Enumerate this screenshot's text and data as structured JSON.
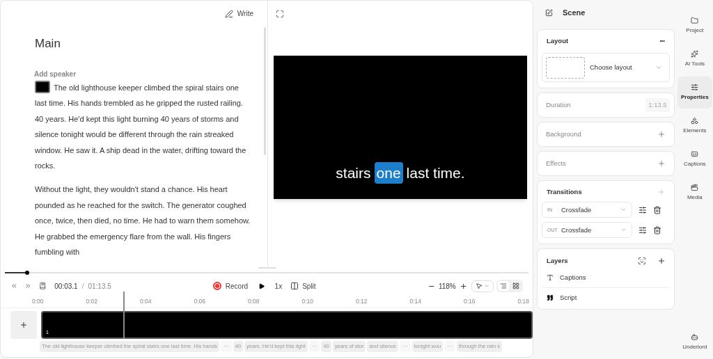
{
  "editor": {
    "write_label": "Write",
    "title": "Main",
    "speaker_label": "Add speaker",
    "paragraphs": [
      "The old lighthouse keeper climbed the spiral stairs one last time. His hands trembled as he gripped the rusted railing. 40 years. He'd kept this light burning 40 years of storms and silence tonight would be different through the rain streaked window. He saw it. A ship dead in the water, drifting toward the rocks.",
      "Without the light, they wouldn't stand a chance. His heart pounded as he reached for the switch. The generator coughed once, twice, then died, no time. He had to warn them somehow. He grabbed the emergency flare from the wall. His fingers fumbling with"
    ]
  },
  "preview": {
    "caption_words": [
      {
        "text": "stairs",
        "selected": false
      },
      {
        "text": "one",
        "selected": true
      },
      {
        "text": "last time.",
        "selected": false
      }
    ]
  },
  "playback": {
    "current_time": "00:03.1",
    "separator": "/",
    "total_time": "01:13.5",
    "record_label": "Record",
    "speed": "1x",
    "split_label": "Split",
    "zoom": "118%"
  },
  "timeline": {
    "ticks": [
      "0:00",
      "0:02",
      "0:04",
      "0:06",
      "0:08",
      "0:10",
      "0:12",
      "0:14",
      "0:16",
      "0:18"
    ],
    "clip_number": "1",
    "chips": [
      {
        "kind": "text",
        "text": "The old lighthouse keeper climbed the spiral stairs one last time. His hands"
      },
      {
        "kind": "gap",
        "text": "···"
      },
      {
        "kind": "text",
        "text": "40"
      },
      {
        "kind": "text",
        "text": "years. He'd kept this light"
      },
      {
        "kind": "gap",
        "text": "···"
      },
      {
        "kind": "text",
        "text": "40"
      },
      {
        "kind": "text",
        "text": "years of stor"
      },
      {
        "kind": "text",
        "text": "and silence"
      },
      {
        "kind": "gap",
        "text": "···"
      },
      {
        "kind": "text",
        "text": "tonight wou"
      },
      {
        "kind": "gap",
        "text": "···"
      },
      {
        "kind": "text",
        "text": "through the rain s"
      }
    ]
  },
  "scene": {
    "title": "Scene",
    "layout": {
      "title": "Layout",
      "more": "•••",
      "choose": "Choose layout"
    },
    "duration": {
      "label": "Duration",
      "value": "1:13.5"
    },
    "sections": [
      {
        "label": "Background"
      },
      {
        "label": "Effects"
      }
    ],
    "transitions": {
      "title": "Transitions",
      "items": [
        {
          "tag": "IN",
          "value": "Crossfade"
        },
        {
          "tag": "OUT",
          "value": "Crossfade"
        }
      ]
    },
    "layers": {
      "title": "Layers",
      "items": [
        {
          "kind": "text",
          "label": "Captions"
        },
        {
          "kind": "quote",
          "label": "Script"
        }
      ]
    }
  },
  "nav": [
    {
      "kind": "folder",
      "label": "Project",
      "selected": false
    },
    {
      "kind": "sparkle",
      "label": "AI Tools",
      "selected": false
    },
    {
      "kind": "sliders",
      "label": "Properties",
      "selected": true
    },
    {
      "kind": "shapes",
      "label": "Elements",
      "selected": false
    },
    {
      "kind": "captions",
      "label": "Captions",
      "selected": false
    },
    {
      "kind": "media",
      "label": "Media",
      "selected": false
    }
  ],
  "bottom_nav": {
    "kind": "robot",
    "label": "Underlord"
  }
}
